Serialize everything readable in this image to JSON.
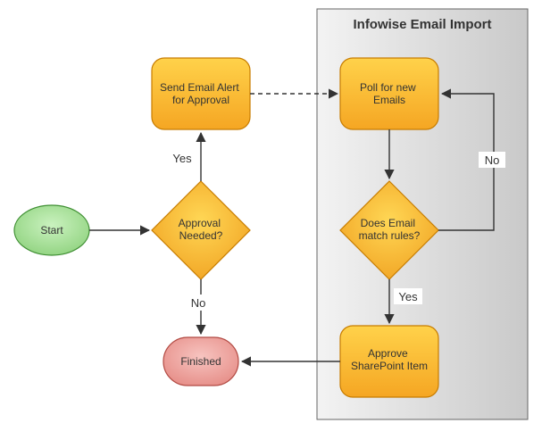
{
  "title": "Infowise Email Import",
  "nodes": {
    "start": "Start",
    "approvalNeeded": "Approval\nNeeded?",
    "sendAlert": "Send Email Alert\nfor Approval",
    "poll": "Poll for new\nEmails",
    "matchRules": "Does Email\nmatch rules?",
    "approve": "Approve\nSharePoint Item",
    "finished": "Finished"
  },
  "edgeLabels": {
    "approvalYes": "Yes",
    "approvalNo": "No",
    "matchYes": "Yes",
    "matchNo": "No"
  }
}
